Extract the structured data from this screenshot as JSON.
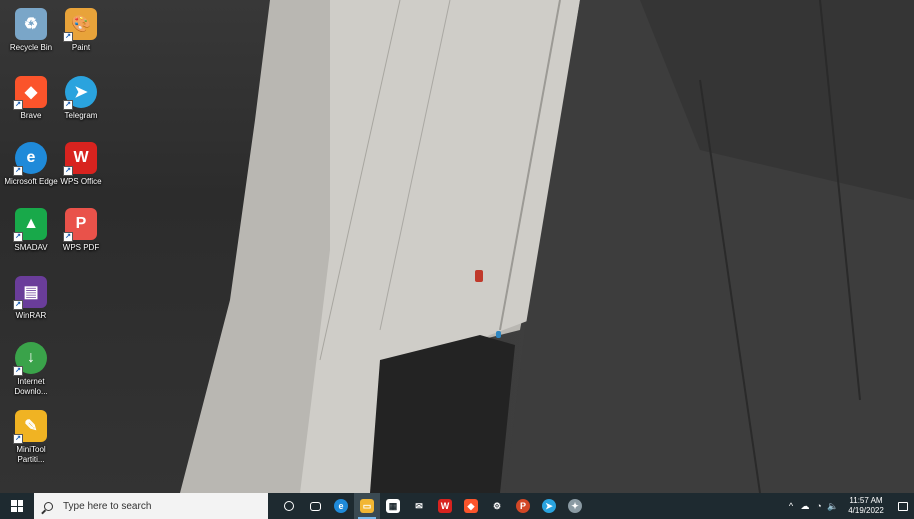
{
  "desktop": {
    "icons": [
      {
        "label": "Recycle Bin",
        "icon": "recycle-bin-icon",
        "color": "#7aa6c8"
      },
      {
        "label": "Paint",
        "icon": "paint-icon",
        "color": "#e8a33a"
      },
      {
        "label": "Brave",
        "icon": "brave-icon",
        "color": "#fb542b"
      },
      {
        "label": "Telegram",
        "icon": "telegram-icon",
        "color": "#2aa3de"
      },
      {
        "label": "Microsoft Edge",
        "icon": "edge-icon",
        "color": "#1f8ad9"
      },
      {
        "label": "WPS Office",
        "icon": "wps-office-icon",
        "color": "#d8231f"
      },
      {
        "label": "SMADAV",
        "icon": "smadav-icon",
        "color": "#18a94a"
      },
      {
        "label": "WPS PDF",
        "icon": "wps-pdf-icon",
        "color": "#e9524a"
      },
      {
        "label": "WinRAR",
        "icon": "winrar-icon",
        "color": "#6a3d9a"
      },
      {
        "label": "Internet Downlo...",
        "icon": "internet-download-manager-icon",
        "color": "#3aa34a"
      },
      {
        "label": "MiniTool Partiti...",
        "icon": "minitool-partition-icon",
        "color": "#f0b323"
      }
    ]
  },
  "taskbar": {
    "search_placeholder": "Type here to search",
    "apps": [
      {
        "name": "cortana-icon",
        "color": "#1e2a30"
      },
      {
        "name": "task-view-icon",
        "color": "#1e2a30"
      },
      {
        "name": "edge-taskbar-icon",
        "color": "#1f8ad9"
      },
      {
        "name": "file-explorer-icon",
        "color": "#f2b632",
        "active": true
      },
      {
        "name": "store-icon",
        "color": "#3b4a52"
      },
      {
        "name": "mail-icon",
        "color": "#3b4a52"
      },
      {
        "name": "wps-taskbar-icon",
        "color": "#d8231f"
      },
      {
        "name": "brave-taskbar-icon",
        "color": "#fb542b"
      },
      {
        "name": "settings-search-icon",
        "color": "#6f7f88"
      },
      {
        "name": "powerpoint-icon",
        "color": "#d24726"
      },
      {
        "name": "telegram-taskbar-icon",
        "color": "#2aa3de"
      },
      {
        "name": "paint-taskbar-icon",
        "color": "#8a9aa3"
      }
    ],
    "time": "11:57 AM",
    "date": "4/19/2022"
  }
}
